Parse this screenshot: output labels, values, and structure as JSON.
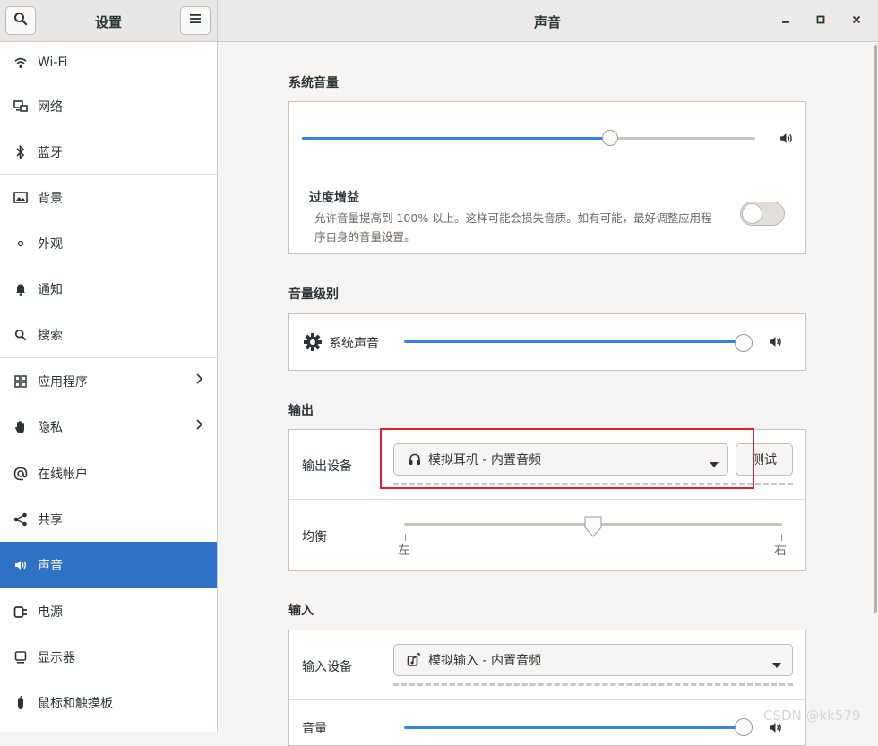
{
  "header": {
    "sidebar_title": "设置",
    "page_title": "声音",
    "search_icon": "search-icon",
    "menu_icon": "hamburger-menu-icon"
  },
  "sidebar": {
    "items": [
      {
        "label": "Wi-Fi",
        "icon": "wifi-icon"
      },
      {
        "label": "网络",
        "icon": "network-icon"
      },
      {
        "label": "蓝牙",
        "icon": "bluetooth-icon"
      },
      {
        "label": "背景",
        "icon": "background-icon"
      },
      {
        "label": "外观",
        "icon": "appearance-icon"
      },
      {
        "label": "通知",
        "icon": "bell-icon"
      },
      {
        "label": "搜索",
        "icon": "search-icon"
      },
      {
        "label": "应用程序",
        "icon": "apps-grid-icon"
      },
      {
        "label": "隐私",
        "icon": "hand-icon"
      },
      {
        "label": "在线帐户",
        "icon": "at-icon"
      },
      {
        "label": "共享",
        "icon": "share-icon"
      },
      {
        "label": "声音",
        "icon": "speaker-icon"
      },
      {
        "label": "电源",
        "icon": "power-plug-icon"
      },
      {
        "label": "显示器",
        "icon": "monitor-icon"
      },
      {
        "label": "鼠标和触摸板",
        "icon": "mouse-icon"
      }
    ],
    "active": "声音"
  },
  "system_volume": {
    "title": "系统音量",
    "level": 0.68,
    "over_amplification": {
      "title": "过度增益",
      "description_line1": "允许音量提高到 100% 以上。这样可能会损失音质。如有可能，最好调整应用程",
      "description_line2": "序自身的音量设置。",
      "enabled": false
    }
  },
  "volume_levels": {
    "title": "音量级别",
    "items": [
      {
        "label": "系统声音",
        "icon": "gear-icon",
        "level": 1.0
      }
    ]
  },
  "output": {
    "title": "输出",
    "device_label": "输出设备",
    "device_value": "模拟耳机 - 内置音频",
    "test_button": "测试",
    "balance_label": "均衡",
    "balance_left": "左",
    "balance_right": "右",
    "balance": 0.5
  },
  "input": {
    "title": "输入",
    "device_label": "输入设备",
    "device_value": "模拟输入 - 内置音频",
    "volume_label": "音量"
  },
  "watermark": "CSDN @kk579",
  "colors": {
    "accent": "#3584e4",
    "sidebar_active": "#2f72c5",
    "highlight_box": "#e0202a"
  }
}
